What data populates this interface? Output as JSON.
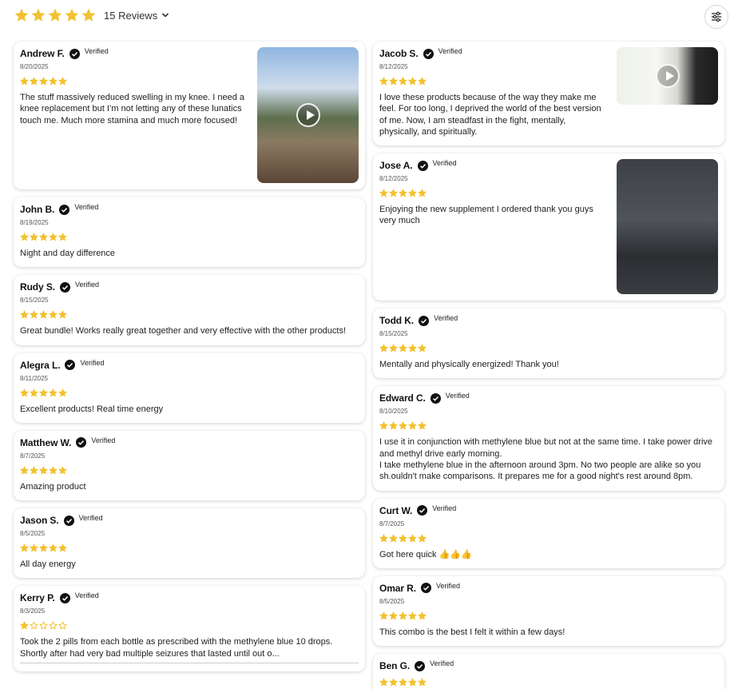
{
  "header": {
    "rating": 5,
    "reviews_label": "15 Reviews",
    "star_color": "#F2C12E"
  },
  "reviews": [
    {
      "name": "Andrew F.",
      "verified": "Verified",
      "date": "8/20/2025",
      "rating": 5,
      "text": "The stuff massively reduced swelling in my knee.  I need a knee replacement but I’m not letting any of these lunatics touch me.  Much more stamina and much more focused!",
      "media": "video"
    },
    {
      "name": "John B.",
      "verified": "Verified",
      "date": "8/19/2025",
      "rating": 5,
      "text": "Night and day difference"
    },
    {
      "name": "Rudy S.",
      "verified": "Verified",
      "date": "8/15/2025",
      "rating": 5,
      "text": "Great bundle! Works really great together and very effective with the other products!"
    },
    {
      "name": "Alegra L.",
      "verified": "Verified",
      "date": "8/11/2025",
      "rating": 5,
      "text": "Excellent products! Real time energy"
    },
    {
      "name": "Matthew W.",
      "verified": "Verified",
      "date": "8/7/2025",
      "rating": 5,
      "text": "Amazing product"
    },
    {
      "name": "Jason S.",
      "verified": "Verified",
      "date": "8/5/2025",
      "rating": 5,
      "text": "All day energy"
    },
    {
      "name": "Kerry P.",
      "verified": "Verified",
      "date": "8/3/2025",
      "rating": 1,
      "text": "Took the 2 pills from each bottle as prescribed with the methylene blue 10 drops. Shortly after had very bad multiple seizures that lasted until out o..."
    },
    {
      "name": "Jacob S.",
      "verified": "Verified",
      "date": "8/12/2025",
      "rating": 5,
      "text": "I love these products because of the way they make me feel. For too long, I deprived the world of the best version of me. Now, I am steadfast in the fight, mentally, physically, and spiritually.",
      "media": "video"
    },
    {
      "name": "Jose A.",
      "verified": "Verified",
      "date": "8/12/2025",
      "rating": 5,
      "text": "Enjoying the new supplement I ordered thank you guys very much",
      "media": "photo"
    },
    {
      "name": "Todd K.",
      "verified": "Verified",
      "date": "8/15/2025",
      "rating": 5,
      "text": "Mentally and physically energized! Thank you!"
    },
    {
      "name": "Edward C.",
      "verified": "Verified",
      "date": "8/10/2025",
      "rating": 5,
      "text": "I use it in conjunction with methylene blue but not at the same time. I take power drive and methyl drive early morning.\nI take methylene blue in the afternoon around 3pm. No two people are alike so you sh.ouldn't make comparisons. It prepares me for a good night's rest around 8pm."
    },
    {
      "name": "Curt W.",
      "verified": "Verified",
      "date": "8/7/2025",
      "rating": 5,
      "text": "Got here quick 👍👍👍"
    },
    {
      "name": "Omar R.",
      "verified": "Verified",
      "date": "8/5/2025",
      "rating": 5,
      "text": "This combo is the best I felt it within a few days!"
    },
    {
      "name": "Ben G.",
      "verified": "Verified",
      "date": "",
      "rating": 5,
      "text": ""
    }
  ]
}
